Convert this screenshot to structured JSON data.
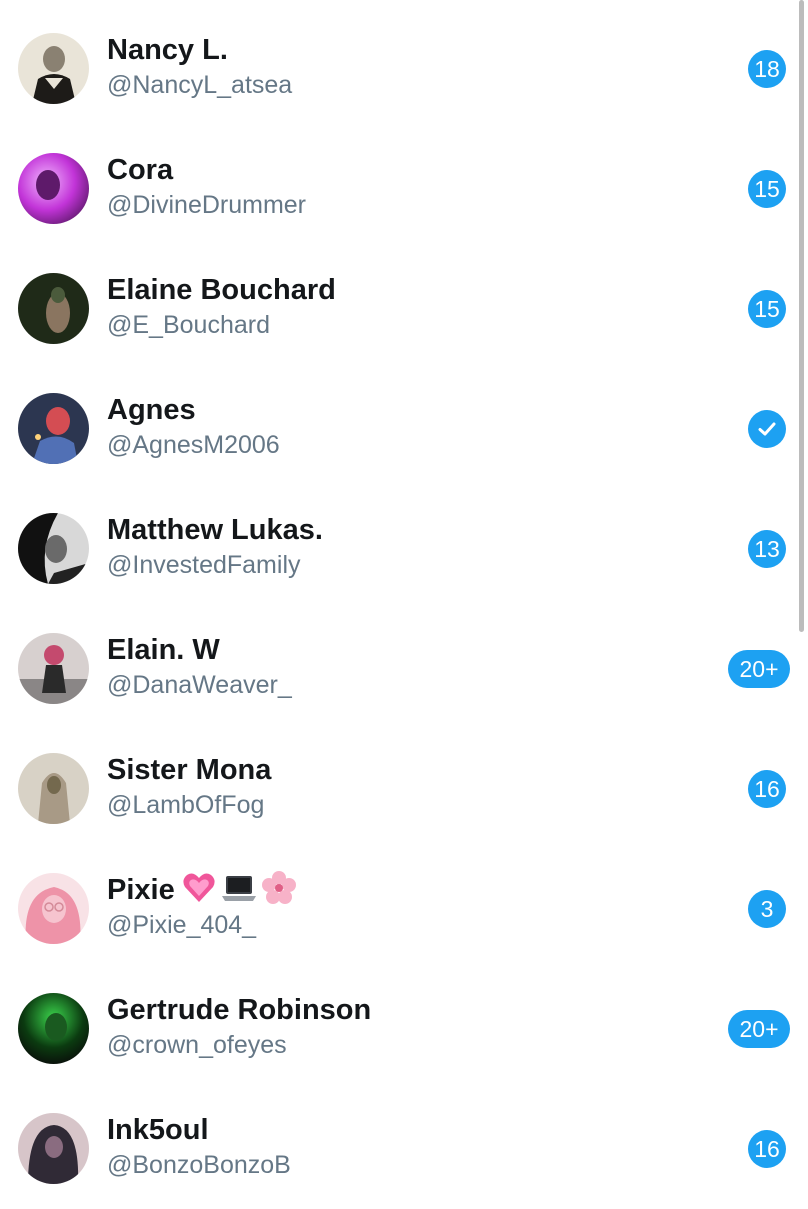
{
  "users": [
    {
      "name": "Nancy L.",
      "handle": "@NancyL_atsea",
      "badge": "18",
      "avatar_colors": [
        "#e9e4d8",
        "#6a635a",
        "#1d1b18"
      ]
    },
    {
      "name": "Cora",
      "handle": "@DivineDrummer",
      "badge": "15",
      "avatar_colors": [
        "#c234d8",
        "#5e1a6a",
        "#f2b7ff"
      ]
    },
    {
      "name": "Elaine Bouchard",
      "handle": "@E_Bouchard",
      "badge": "15",
      "avatar_colors": [
        "#1f2a18",
        "#4b5b3c",
        "#bfa890"
      ]
    },
    {
      "name": "Agnes",
      "handle": "@AgnesM2006",
      "badge": "",
      "badge_icon": "check-icon",
      "avatar_colors": [
        "#5170b5",
        "#d44d53",
        "#f3c3a0"
      ]
    },
    {
      "name": "Matthew Lukas.",
      "handle": "@InvestedFamily",
      "badge": "13",
      "avatar_colors": [
        "#e8e8e8",
        "#595959",
        "#111111"
      ]
    },
    {
      "name": "Elain. W",
      "handle": "@DanaWeaver_",
      "badge": "20+",
      "avatar_colors": [
        "#d7d0cf",
        "#c44a6e",
        "#2a2a2a"
      ]
    },
    {
      "name": "Sister Mona",
      "handle": "@LambOfFog",
      "badge": "16",
      "avatar_colors": [
        "#a89a86",
        "#74694e",
        "#d8d2c6"
      ]
    },
    {
      "name": "Pixie",
      "handle": "@Pixie_404_",
      "badge": "3",
      "emojis": [
        "pink-heart-icon",
        "laptop-icon",
        "cherry-blossom-icon"
      ],
      "avatar_colors": [
        "#f6c4cf",
        "#ee93a8",
        "#f8e2e6"
      ]
    },
    {
      "name": "Gertrude Robinson",
      "handle": "@crown_ofeyes",
      "badge": "20+",
      "avatar_colors": [
        "#0b3b10",
        "#3bd44c",
        "#0a0a0a"
      ]
    },
    {
      "name": "Ink5oul",
      "handle": "@BonzoBonzoB",
      "badge": "16",
      "avatar_colors": [
        "#302a36",
        "#8a6c80",
        "#d7c5c9"
      ]
    }
  ],
  "accent_color": "#1da1f2",
  "name_color": "#14171a",
  "handle_color": "#657786"
}
